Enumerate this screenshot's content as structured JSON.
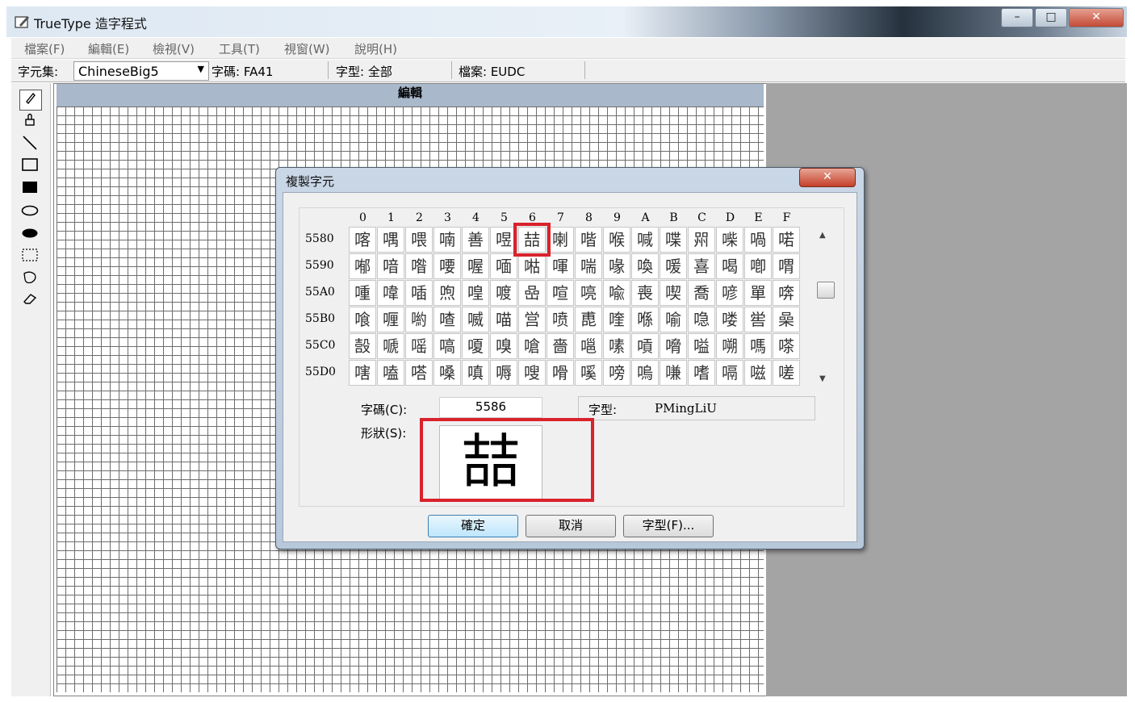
{
  "window": {
    "title": "TrueType 造字程式",
    "icons": [
      "app-pen-icon"
    ],
    "minimize": "–",
    "maximize": "□",
    "close": "✕"
  },
  "menu": [
    "檔案(F)",
    "編輯(E)",
    "檢視(V)",
    "工具(T)",
    "視窗(W)",
    "說明(H)"
  ],
  "infobar": {
    "charset_label": "字元集:",
    "charset_value": "ChineseBig5",
    "code": "字碼: FA41",
    "font": "字型: 全部",
    "file": "檔案: EUDC"
  },
  "tools": [
    "pencil-icon",
    "brush-icon",
    "line-icon",
    "rectangle-outline-icon",
    "rectangle-filled-icon",
    "ellipse-outline-icon",
    "ellipse-filled-icon",
    "rect-select-icon",
    "freeform-select-icon",
    "eraser-icon"
  ],
  "editor": {
    "header": "編輯"
  },
  "dialog": {
    "title": "複製字元",
    "close": "✕",
    "columns": [
      "0",
      "1",
      "2",
      "3",
      "4",
      "5",
      "6",
      "7",
      "8",
      "9",
      "A",
      "B",
      "C",
      "D",
      "E",
      "F"
    ],
    "rows": [
      {
        "label": "5580",
        "chars": [
          "喀",
          "喁",
          "喂",
          "喃",
          "善",
          "喅",
          "喆",
          "喇",
          "喈",
          "喉",
          "喊",
          "喋",
          "喌",
          "喍",
          "喎",
          "喏"
        ]
      },
      {
        "label": "5590",
        "chars": [
          "喐",
          "喑",
          "喒",
          "喓",
          "喔",
          "喕",
          "喖",
          "喗",
          "喘",
          "喙",
          "喚",
          "喛",
          "喜",
          "喝",
          "喞",
          "喟"
        ]
      },
      {
        "label": "55A0",
        "chars": [
          "喠",
          "喡",
          "喢",
          "喣",
          "喤",
          "喥",
          "喦",
          "喧",
          "喨",
          "喩",
          "喪",
          "喫",
          "喬",
          "喭",
          "單",
          "喯"
        ]
      },
      {
        "label": "55B0",
        "chars": [
          "喰",
          "喱",
          "喲",
          "喳",
          "喴",
          "喵",
          "営",
          "喷",
          "喸",
          "喹",
          "喺",
          "喻",
          "喼",
          "喽",
          "喾",
          "喿"
        ]
      },
      {
        "label": "55C0",
        "chars": [
          "嗀",
          "嗁",
          "嗂",
          "嗃",
          "嗄",
          "嗅",
          "嗆",
          "嗇",
          "嗈",
          "嗉",
          "嗊",
          "嗋",
          "嗌",
          "嗍",
          "嗎",
          "嗏"
        ]
      },
      {
        "label": "55D0",
        "chars": [
          "嗐",
          "嗑",
          "嗒",
          "嗓",
          "嗔",
          "嗕",
          "嗖",
          "嗗",
          "嗘",
          "嗙",
          "嗚",
          "嗛",
          "嗜",
          "嗝",
          "嗞",
          "嗟"
        ]
      }
    ],
    "code_label": "字碼(C):",
    "code_value": "5586",
    "font_label": "字型:",
    "font_value": "PMingLiU",
    "shape_label": "形狀(S):",
    "shape_char": "喆",
    "ok": "確定",
    "cancel": "取消",
    "font_button": "字型(F)..."
  }
}
